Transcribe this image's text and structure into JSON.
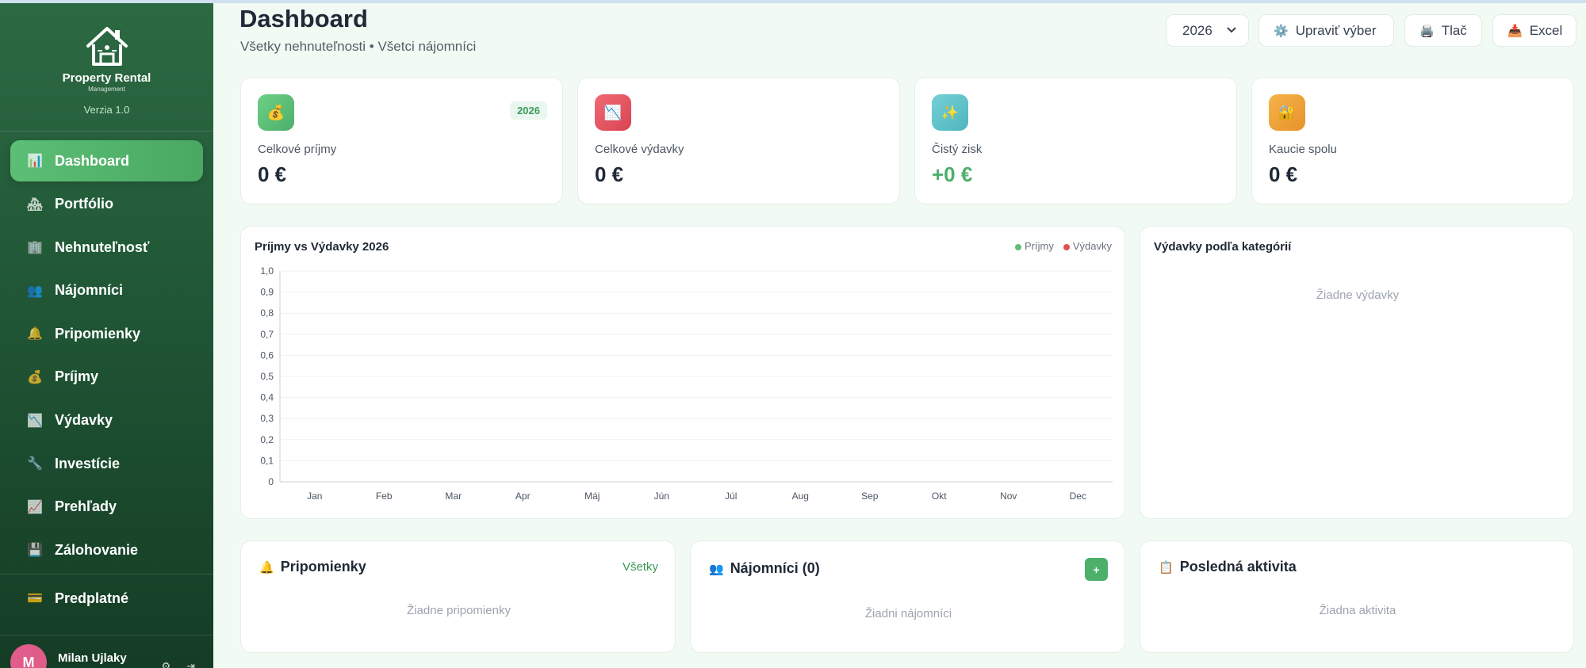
{
  "brand": {
    "name": "Property Rental",
    "sub": "Management",
    "version": "Verzia 1.0"
  },
  "nav": [
    {
      "label": "Dashboard",
      "icon": "📊"
    },
    {
      "label": "Portfólio",
      "icon": "🏘"
    },
    {
      "label": "Nehnuteľnosť",
      "icon": "🏢"
    },
    {
      "label": "Nájomníci",
      "icon": "👥"
    },
    {
      "label": "Pripomienky",
      "icon": "🔔"
    },
    {
      "label": "Príjmy",
      "icon": "💰"
    },
    {
      "label": "Výdavky",
      "icon": "📉"
    },
    {
      "label": "Investície",
      "icon": "🔧"
    },
    {
      "label": "Prehľady",
      "icon": "📈"
    },
    {
      "label": "Zálohovanie",
      "icon": "💾"
    }
  ],
  "nav_bottom": {
    "label": "Predplatné",
    "icon": "💳"
  },
  "user": {
    "initial": "M",
    "name": "Milan Ujlaky"
  },
  "header": {
    "title": "Dashboard",
    "subtitle": "Všetky nehnuteľnosti • Všetci nájomníci",
    "year": "2026",
    "edit_label": "Upraviť výber",
    "print_label": "Tlač",
    "excel_label": "Excel"
  },
  "stats": [
    {
      "label": "Celkové príjmy",
      "value": "0 €",
      "icon": "💰",
      "color": "#5cbf75",
      "badge": "2026"
    },
    {
      "label": "Celkové výdavky",
      "value": "0 €",
      "icon": "📉",
      "color": "#e0505f"
    },
    {
      "label": "Čistý zisk",
      "value": "+0 €",
      "icon": "✨",
      "color": "#5bc2c9"
    },
    {
      "label": "Kaucie spolu",
      "value": "0 €",
      "icon": "🔐",
      "color": "#f0a43a"
    }
  ],
  "chart_panel": {
    "legend_income": "Príjmy",
    "legend_expense": "Výdavky",
    "income_color": "#5cbf75",
    "expense_color": "#e05050"
  },
  "chart_data": {
    "type": "line",
    "title": "Príjmy vs Výdavky 2026",
    "categories": [
      "Jan",
      "Feb",
      "Mar",
      "Apr",
      "Máj",
      "Jún",
      "Júl",
      "Aug",
      "Sep",
      "Okt",
      "Nov",
      "Dec"
    ],
    "series": [
      {
        "name": "Príjmy",
        "values": [
          0,
          0,
          0,
          0,
          0,
          0,
          0,
          0,
          0,
          0,
          0,
          0
        ]
      },
      {
        "name": "Výdavky",
        "values": [
          0,
          0,
          0,
          0,
          0,
          0,
          0,
          0,
          0,
          0,
          0,
          0
        ]
      }
    ],
    "yticks": [
      "0",
      "0,1",
      "0,2",
      "0,3",
      "0,4",
      "0,5",
      "0,6",
      "0,7",
      "0,8",
      "0,9",
      "1,0"
    ],
    "ylim": [
      0,
      1
    ],
    "grid": true,
    "legend": "top-right"
  },
  "expense_panel": {
    "title": "Výdavky podľa kategórií",
    "empty": "Žiadne výdavky"
  },
  "reminders": {
    "title": "Pripomienky",
    "icon": "🔔",
    "link": "Všetky",
    "empty": "Žiadne pripomienky"
  },
  "tenants": {
    "title": "Nájomníci (0)",
    "icon": "👥",
    "add": "+",
    "empty": "Žiadni nájomníci"
  },
  "activity": {
    "title": "Posledná aktivita",
    "icon": "📋",
    "empty": "Žiadna aktivita"
  }
}
